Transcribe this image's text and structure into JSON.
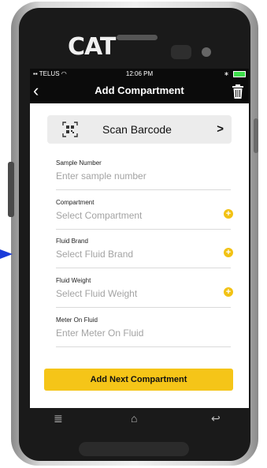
{
  "device": {
    "logo_text": "CAT"
  },
  "status_bar": {
    "carrier": "TELUS",
    "time": "12:06 PM"
  },
  "nav": {
    "title": "Add Compartment"
  },
  "scan": {
    "label": "Scan Barcode",
    "chevron": ">"
  },
  "fields": [
    {
      "label": "Sample Number",
      "placeholder": "Enter sample number",
      "has_add": false
    },
    {
      "label": "Compartment",
      "placeholder": "Select Compartment",
      "has_add": true
    },
    {
      "label": "Fluid Brand",
      "placeholder": "Select Fluid Brand",
      "has_add": true
    },
    {
      "label": "Fluid Weight",
      "placeholder": "Select Fluid Weight",
      "has_add": true
    },
    {
      "label": "Meter On Fluid",
      "placeholder": "Enter Meter On Fluid",
      "has_add": false
    }
  ],
  "actions": {
    "next_label": "Add Next Compartment"
  },
  "colors": {
    "accent": "#f5c518",
    "nav_bg": "#0b0b0b",
    "pointer_arrow": "#1a3bd9"
  },
  "icons": {
    "back": "chevron-left-icon",
    "trash": "trash-icon",
    "qr": "qr-code-icon",
    "add": "plus-circle-icon",
    "softkeys": [
      "menu-icon",
      "home-icon",
      "back-arrow-icon"
    ]
  }
}
